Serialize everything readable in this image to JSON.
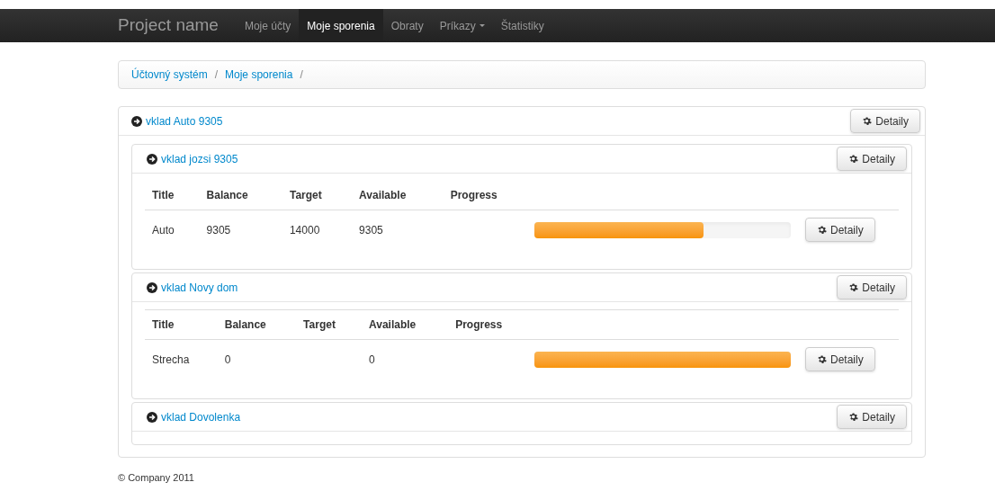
{
  "brand": "Project name",
  "nav": [
    {
      "label": "Moje účty",
      "selected": false,
      "dropdown": false
    },
    {
      "label": "Moje sporenia",
      "selected": true,
      "dropdown": false
    },
    {
      "label": "Obraty",
      "selected": false,
      "dropdown": false
    },
    {
      "label": "Príkazy",
      "selected": false,
      "dropdown": true
    },
    {
      "label": "Štatistiky",
      "selected": false,
      "dropdown": false
    }
  ],
  "breadcrumb": [
    {
      "label": "Účtovný systém",
      "separator": "/"
    },
    {
      "label": "Moje sporenia",
      "separator": "/"
    }
  ],
  "panel": {
    "title": "vklad Auto 9305",
    "button": "Detaily",
    "children": [
      {
        "title": "vklad jozsi 9305",
        "button": "Detaily",
        "columns": [
          "Title",
          "Balance",
          "Target",
          "Available",
          "Progress"
        ],
        "rows": [
          {
            "cells": [
              "Auto",
              "9305",
              "14000",
              "9305"
            ],
            "level": 0.66,
            "button": "Detaily"
          }
        ]
      },
      {
        "title": "vklad Novy dom",
        "button": "Detaily",
        "columns": [
          "Title",
          "Balance",
          "Target",
          "Available",
          "Progress"
        ],
        "rows": [
          {
            "cells": [
              "Strecha",
              "0",
              "",
              "0"
            ],
            "level": 1,
            "button": "Detaily"
          }
        ]
      },
      {
        "title": "vklad Dovolenka",
        "button": "Detaily"
      }
    ]
  },
  "footer": "© Company 2011"
}
